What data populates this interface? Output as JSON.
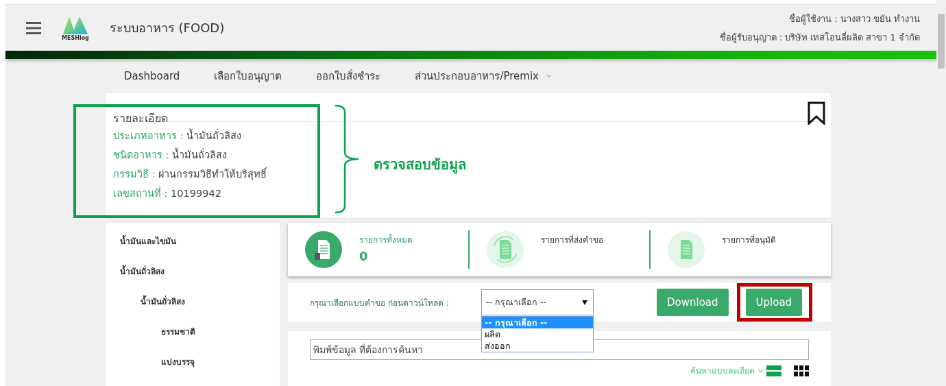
{
  "header": {
    "title": "ระบบอาหาร (FOOD)",
    "logo_text": "MESHlog",
    "user_line": "ชื่อผู้ใช้งาน : นางสาว ขยัน ทำงาน",
    "licensee_line": "ชื่อผู้รับอนุญาต : บริษัท เทสโอนลี่ผลิต สาขา 1 จำกัด"
  },
  "nav": [
    {
      "label": "Dashboard",
      "dropdown": false
    },
    {
      "label": "เลือกใบอนุญาต",
      "dropdown": false
    },
    {
      "label": "ออกใบสั่งชำระ",
      "dropdown": false
    },
    {
      "label": "ส่วนประกอบอาหาร/Premix",
      "dropdown": true
    }
  ],
  "details": {
    "heading": "รายละเอียด",
    "fields": [
      {
        "label": "ประเภทอาหาร :",
        "value": "น้ำมันถั่วลิสง"
      },
      {
        "label": "ชนิดอาหาร :",
        "value": "น้ำมันถั่วลิสง"
      },
      {
        "label": "กรรมวิธี :",
        "value": "ผ่านกรรมวิธีทำให้บริสุทธิ์"
      },
      {
        "label": "เลขสถานที่ :",
        "value": "10199942"
      }
    ],
    "annotation": "ตรวจสอบข้อมูล"
  },
  "sidebar": {
    "items": [
      {
        "label": "น้ำมันและไขมัน"
      },
      {
        "label": "น้ำมันถั่วลิสง",
        "children": [
          {
            "label": "น้ำมันถั่วลิสง",
            "children": [
              {
                "label": "ธรรมชาติ"
              },
              {
                "label": "แบ่งบรรจุ"
              }
            ]
          }
        ]
      }
    ]
  },
  "stats": [
    {
      "label": "รายการทั้งหมด",
      "value": "0",
      "active": true
    },
    {
      "label": "รายการที่ส่งคำขอ",
      "active": false
    },
    {
      "label": "รายการที่อนุมัติ",
      "active": false
    }
  ],
  "download_form": {
    "label": "กรุณาเลือกแบบคำขอ ก่อนดาวน์โหลด :",
    "select_value": "-- กรุณาเลือก --",
    "options": [
      {
        "label": "-- กรุณาเลือก --",
        "selected": true
      },
      {
        "label": "ผลิต",
        "selected": false
      },
      {
        "label": "ส่งออก",
        "selected": false
      }
    ],
    "buttons": [
      {
        "label": "Download",
        "highlighted": false
      },
      {
        "label": "Upload",
        "highlighted": true
      }
    ]
  },
  "search": {
    "placeholder": "พิมพ์ข้อมูล ที่ต้องการค้นหา",
    "advanced_link": "ค้นหาแบบละเอียด"
  }
}
